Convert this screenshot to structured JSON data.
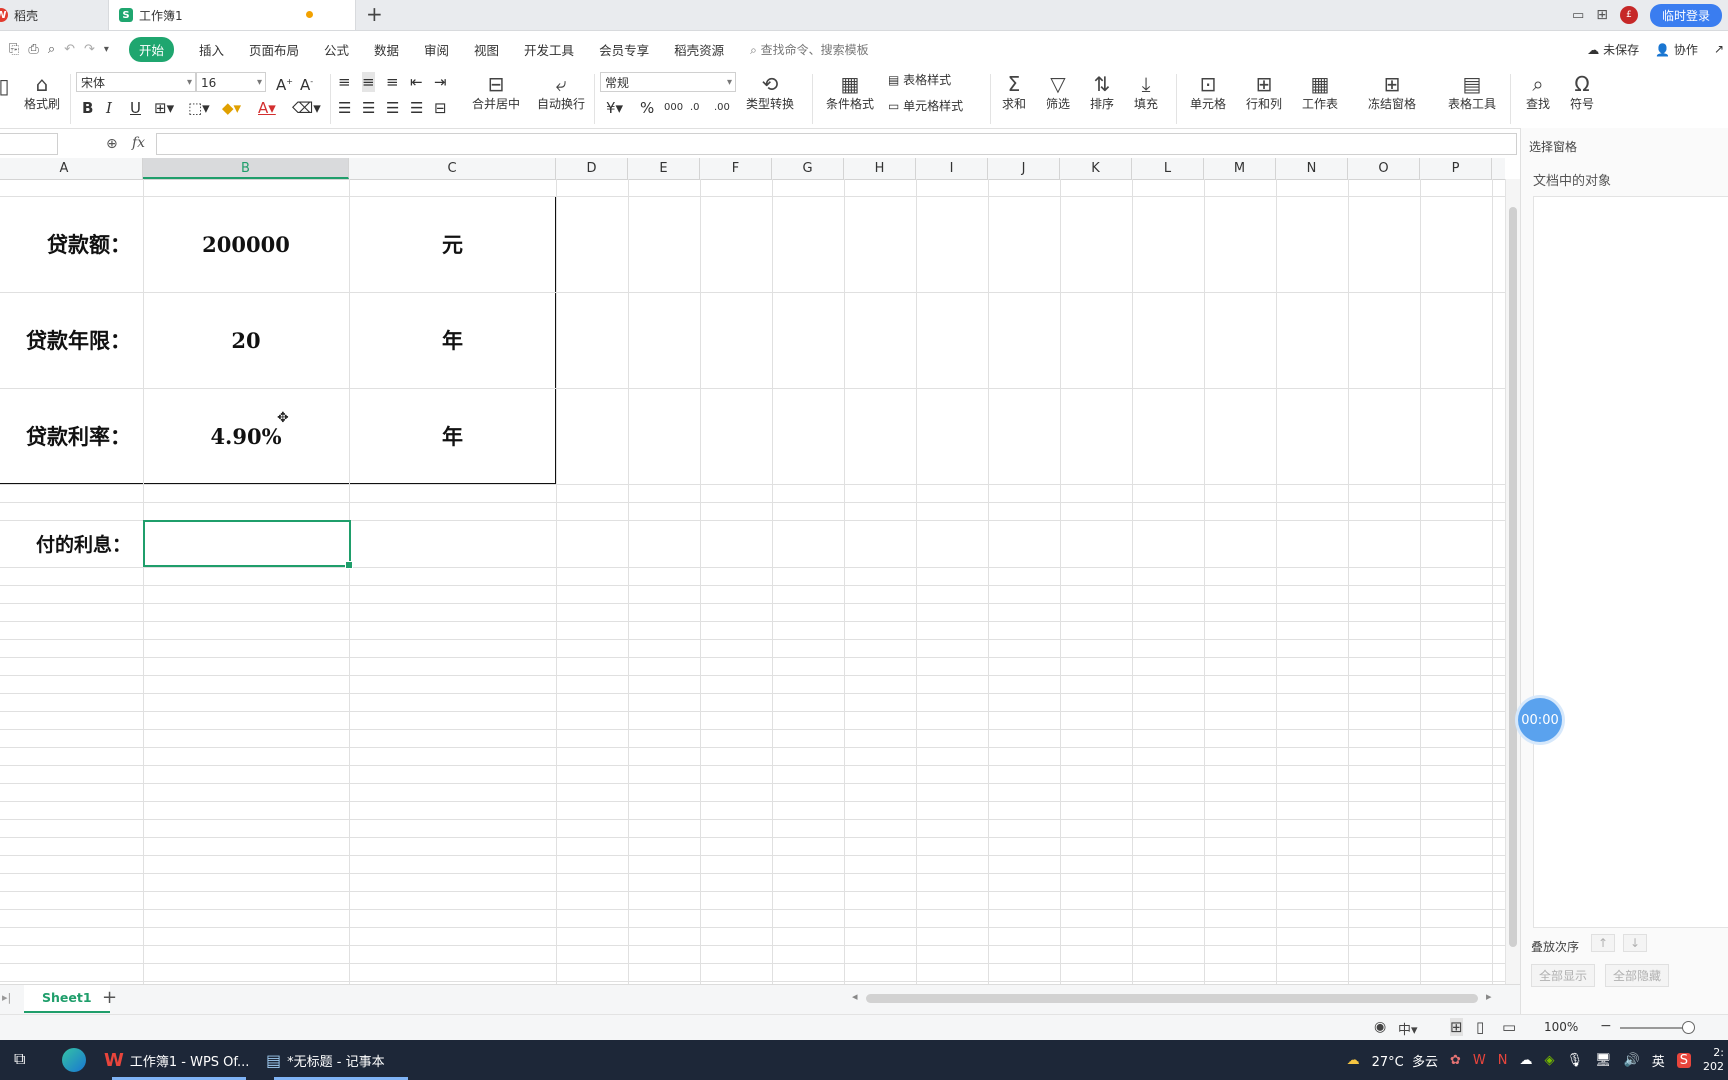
{
  "tabs": [
    {
      "label": "稻壳"
    },
    {
      "label": "工作簿1"
    }
  ],
  "topbar": {
    "login_label": "临时登录",
    "avatar_text": "£"
  },
  "menu": {
    "items": [
      "开始",
      "插入",
      "页面布局",
      "公式",
      "数据",
      "审阅",
      "视图",
      "开发工具",
      "会员专享",
      "稻壳资源"
    ],
    "search_placeholder": "查找命令、搜索模板",
    "unsaved": "未保存",
    "collab": "协作"
  },
  "ribbon": {
    "brush": "格式刷",
    "font_name": "宋体",
    "font_size": "16",
    "merge_center": "合并居中",
    "wrap": "自动换行",
    "num_format": "常规",
    "convert": "类型转换",
    "cond_format": "条件格式",
    "table_style": "表格样式",
    "cell_style": "单元格样式",
    "sum": "求和",
    "filter": "筛选",
    "sort": "排序",
    "fill": "填充",
    "cell": "单元格",
    "rowcol": "行和列",
    "sheet": "工作表",
    "freeze": "冻结窗格",
    "table_tools": "表格工具",
    "find": "查找",
    "symbol": "符号"
  },
  "formula": {
    "fx": "fx",
    "value": ""
  },
  "columns": [
    "A",
    "B",
    "C",
    "D",
    "E",
    "F",
    "G",
    "H",
    "I",
    "J",
    "K",
    "L",
    "M",
    "N",
    "O",
    "P"
  ],
  "selected_column": "B",
  "cells": {
    "a1": "贷款额：",
    "b1": "200000",
    "c1": "元",
    "a2": "贷款年限：",
    "b2": "20",
    "c2": "年",
    "a3": "贷款利率：",
    "b3": "4.90%",
    "c3": "年",
    "a5": "付的利息：",
    "b5": ""
  },
  "pane": {
    "title": "选择窗格",
    "subtitle": "文档中的对象",
    "order": "叠放次序",
    "show_all": "全部显示",
    "hide_all": "全部隐藏"
  },
  "timer": "00:00",
  "sheets": [
    {
      "name": "Sheet1"
    }
  ],
  "status": {
    "zoom": "100%"
  },
  "taskbar": {
    "wps": "工作簿1 - WPS Of...",
    "notepad": "*无标题 - 记事本",
    "weather": "27°C  多云",
    "ime": "英",
    "time": "2:",
    "date": "202"
  }
}
